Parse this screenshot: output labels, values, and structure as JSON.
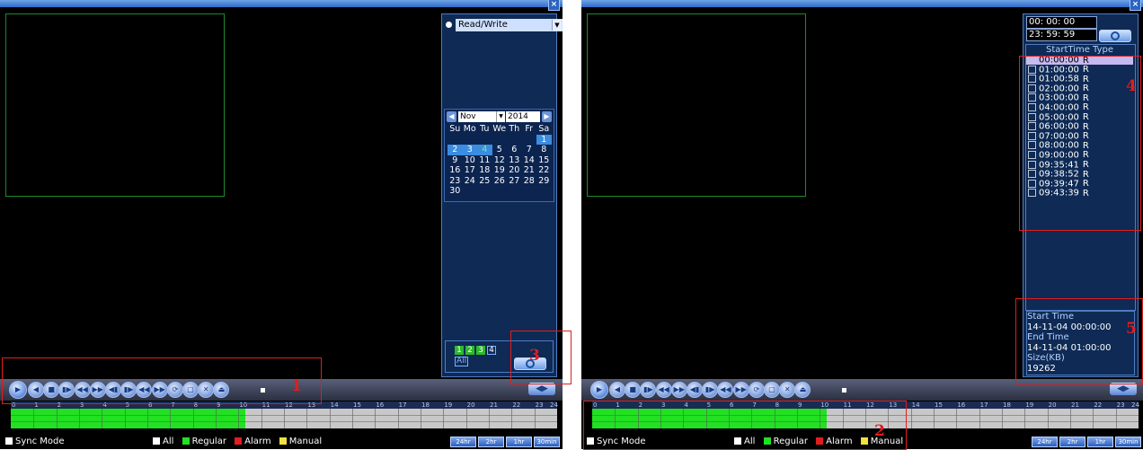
{
  "left": {
    "close_glyph": "×",
    "mode_select": "Read/Write",
    "calendar": {
      "month": "Nov",
      "year": "2014",
      "weekdays": [
        "Su",
        "Mo",
        "Tu",
        "We",
        "Th",
        "Fr",
        "Sa"
      ],
      "rows": [
        [
          "",
          "",
          "",
          "",
          "",
          "",
          "1"
        ],
        [
          "2",
          "3",
          "4",
          "5",
          "6",
          "7",
          "8"
        ],
        [
          "9",
          "10",
          "11",
          "12",
          "13",
          "14",
          "15"
        ],
        [
          "16",
          "17",
          "18",
          "19",
          "20",
          "21",
          "22"
        ],
        [
          "23",
          "24",
          "25",
          "26",
          "27",
          "28",
          "29"
        ],
        [
          "30",
          "",
          "",
          "",
          "",
          "",
          ""
        ]
      ]
    },
    "channels": [
      "1",
      "2",
      "3",
      "4"
    ],
    "channel_all": "All",
    "annotation_1": "1",
    "annotation_3": "3"
  },
  "right": {
    "start_time": "00: 00: 00",
    "end_time": "23: 59: 59",
    "list_header": "StartTime Type",
    "files": [
      {
        "time": "00:00:00",
        "type": "R"
      },
      {
        "time": "01:00:00",
        "type": "R"
      },
      {
        "time": "01:00:58",
        "type": "R"
      },
      {
        "time": "02:00:00",
        "type": "R"
      },
      {
        "time": "03:00:00",
        "type": "R"
      },
      {
        "time": "04:00:00",
        "type": "R"
      },
      {
        "time": "05:00:00",
        "type": "R"
      },
      {
        "time": "06:00:00",
        "type": "R"
      },
      {
        "time": "07:00:00",
        "type": "R"
      },
      {
        "time": "08:00:00",
        "type": "R"
      },
      {
        "time": "09:00:00",
        "type": "R"
      },
      {
        "time": "09:35:41",
        "type": "R"
      },
      {
        "time": "09:38:52",
        "type": "R"
      },
      {
        "time": "09:39:47",
        "type": "R"
      },
      {
        "time": "09:43:39",
        "type": "R"
      }
    ],
    "info": {
      "start_label": "Start Time",
      "start_value": "14-11-04 00:00:00",
      "end_label": "End Time",
      "end_value": "14-11-04 01:00:00",
      "size_label": "Size(KB)",
      "size_value": "19262"
    },
    "annotation_2": "2",
    "annotation_4": "4",
    "annotation_5": "5"
  },
  "timeline": {
    "hours": [
      "0",
      "1",
      "2",
      "3",
      "4",
      "5",
      "6",
      "7",
      "8",
      "9",
      "10",
      "11",
      "12",
      "13",
      "14",
      "15",
      "16",
      "17",
      "18",
      "19",
      "20",
      "21",
      "22",
      "23",
      "24"
    ],
    "recorded_until_hour": 10.3
  },
  "bottom": {
    "sync_mode": "Sync Mode",
    "legend_all": "All",
    "legend_regular": "Regular",
    "legend_alarm": "Alarm",
    "legend_manual": "Manual",
    "zoom_24": "24hr",
    "zoom_2": "2hr",
    "zoom_1": "1hr",
    "zoom_30": "30min"
  },
  "colors": {
    "regular": "#22e022",
    "alarm": "#e01e1e",
    "manual": "#f0e040",
    "annotation": "#e01e1e"
  },
  "controls": [
    "play-icon",
    "reverse-play-icon",
    "stop-icon",
    "slow-play-icon",
    "fast-backward-icon",
    "fast-forward-icon",
    "previous-frame-icon",
    "next-frame-icon",
    "previous-file-icon",
    "next-file-icon",
    "loop-icon",
    "fullscreen-icon",
    "cut-icon",
    "backup-icon"
  ]
}
